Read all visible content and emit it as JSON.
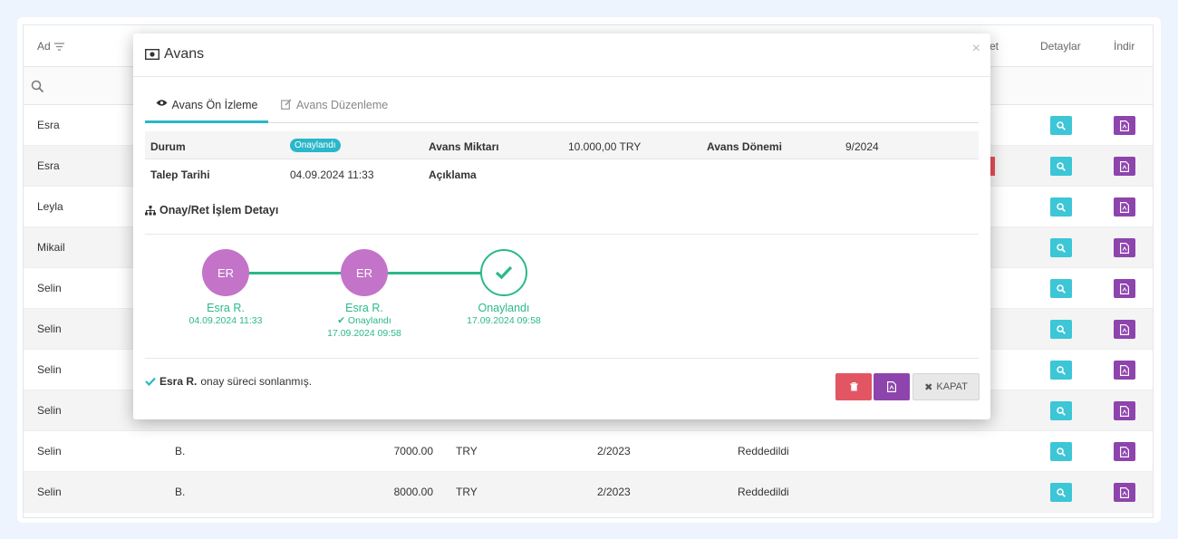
{
  "table": {
    "headers": {
      "name": "Ad",
      "status_partial": "et",
      "details": "Detaylar",
      "download": "İndir"
    },
    "rows": [
      {
        "name": "Esra",
        "c2": "",
        "amount": "",
        "currency": "",
        "period": "",
        "status": ""
      },
      {
        "name": "Esra",
        "c2": "",
        "amount": "",
        "currency": "",
        "period": "",
        "status": ""
      },
      {
        "name": "Leyla",
        "c2": "",
        "amount": "",
        "currency": "",
        "period": "",
        "status": ""
      },
      {
        "name": "Mikail",
        "c2": "",
        "amount": "",
        "currency": "",
        "period": "",
        "status": ""
      },
      {
        "name": "Selin",
        "c2": "",
        "amount": "",
        "currency": "",
        "period": "",
        "status": ""
      },
      {
        "name": "Selin",
        "c2": "",
        "amount": "",
        "currency": "",
        "period": "",
        "status": ""
      },
      {
        "name": "Selin",
        "c2": "",
        "amount": "",
        "currency": "",
        "period": "",
        "status": ""
      },
      {
        "name": "Selin",
        "c2": "",
        "amount": "",
        "currency": "",
        "period": "",
        "status": ""
      },
      {
        "name": "Selin",
        "c2": "B.",
        "amount": "7000.00",
        "currency": "TRY",
        "period": "2/2023",
        "status": "Reddedildi"
      },
      {
        "name": "Selin",
        "c2": "B.",
        "amount": "8000.00",
        "currency": "TRY",
        "period": "2/2023",
        "status": "Reddedildi"
      }
    ]
  },
  "modal": {
    "title": "Avans",
    "close_symbol": "×",
    "tabs": {
      "preview": "Avans Ön İzleme",
      "edit": "Avans Düzenleme"
    },
    "info": {
      "status_label": "Durum",
      "status_value": "Onaylandı",
      "amount_label": "Avans Miktarı",
      "amount_value": "10.000,00 TRY",
      "period_label": "Avans Dönemi",
      "period_value": "9/2024",
      "request_date_label": "Talep Tarihi",
      "request_date_value": "04.09.2024 11:33",
      "description_label": "Açıklama",
      "description_value": ""
    },
    "section_title": "Onay/Ret İşlem Detayı",
    "timeline": [
      {
        "initials": "ER",
        "name": "Esra R.",
        "sub": "",
        "date": "04.09.2024 11:33"
      },
      {
        "initials": "ER",
        "name": "Esra R.",
        "sub": "Onaylandı",
        "date": "17.09.2024 09:58"
      },
      {
        "initials": "",
        "name": "Onaylandı",
        "sub": "",
        "date": "17.09.2024 09:58"
      }
    ],
    "footer": {
      "person": "Esra R.",
      "note": "onay süreci sonlanmış.",
      "close_label": "KAPAT"
    }
  },
  "colors": {
    "teal": "#2ab7c9",
    "purple": "#8e44ad",
    "green": "#2bb98a",
    "avatar": "#c374c9",
    "danger": "#e25563"
  }
}
